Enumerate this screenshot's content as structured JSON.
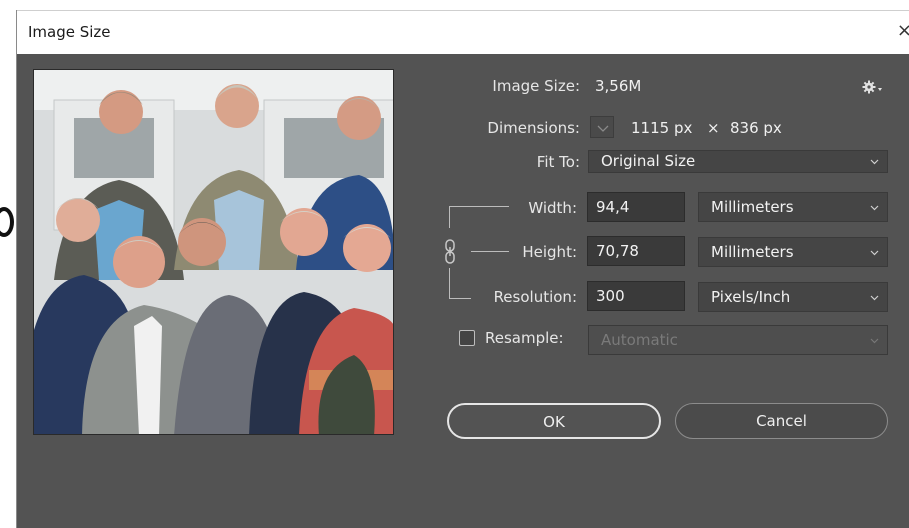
{
  "window": {
    "title": "Image Size"
  },
  "info": {
    "image_size_label": "Image Size:",
    "image_size_value": "3,56M",
    "dimensions_label": "Dimensions:",
    "dimensions_width": "1115 px",
    "dimensions_times": "×",
    "dimensions_height": "836 px",
    "fit_to_label": "Fit To:",
    "fit_to_value": "Original Size"
  },
  "fields": {
    "width_label": "Width:",
    "width_value": "94,4",
    "width_unit": "Millimeters",
    "height_label": "Height:",
    "height_value": "70,78",
    "height_unit": "Millimeters",
    "resolution_label": "Resolution:",
    "resolution_value": "300",
    "resolution_unit": "Pixels/Inch",
    "resample_label": "Resample:",
    "resample_value": "Automatic",
    "resample_checked": false
  },
  "buttons": {
    "ok": "OK",
    "cancel": "Cancel"
  },
  "icons": {
    "settings": "gear-icon",
    "link": "chain-link-icon",
    "dropdown": "chevron-down-icon"
  },
  "colors": {
    "dialog_bg": "#535353",
    "input_bg": "#3a3a3a",
    "text": "#e6e6e6"
  }
}
